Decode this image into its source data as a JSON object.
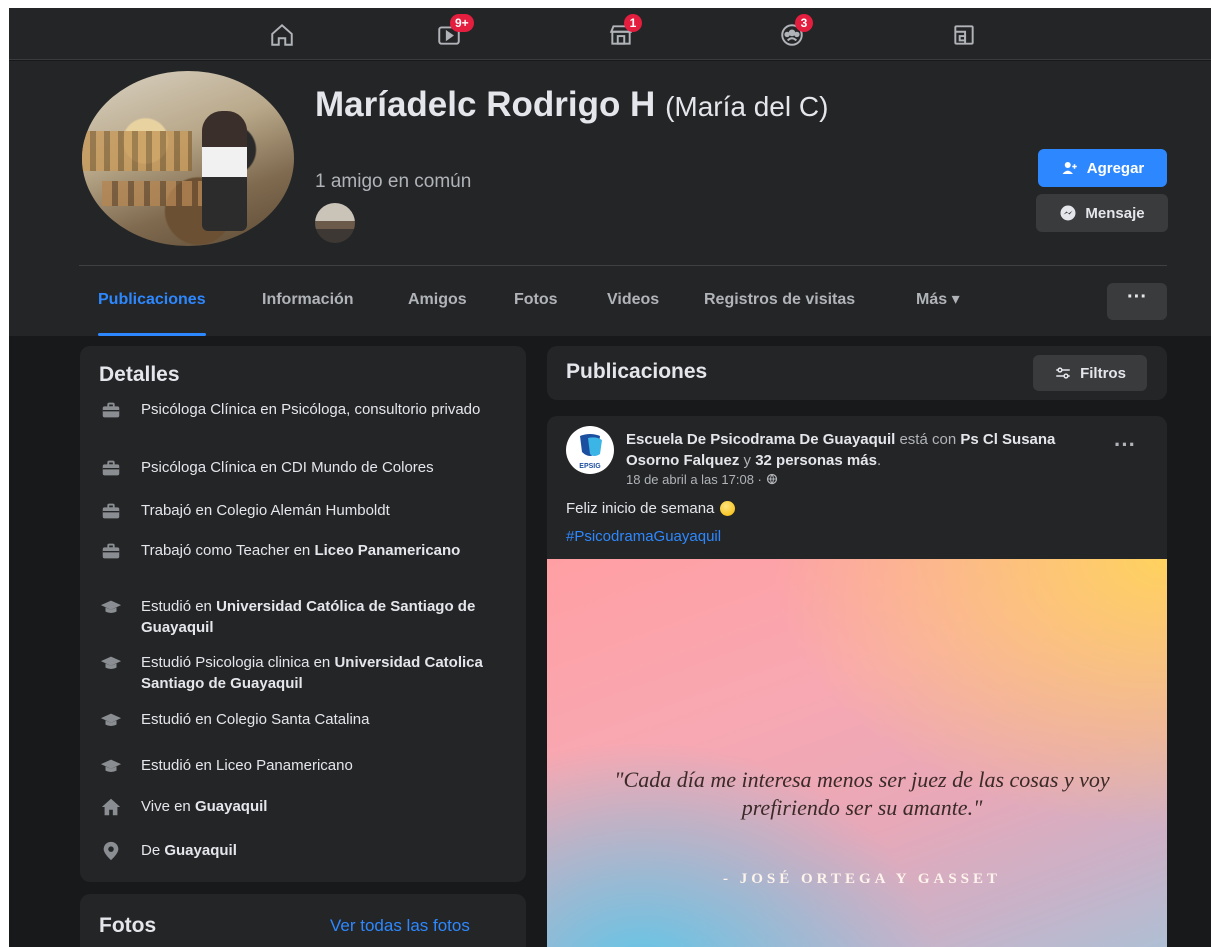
{
  "nav": {
    "badges": {
      "watch": "9+",
      "marketplace": "1",
      "groups": "3"
    }
  },
  "profile": {
    "name": "Maríadelc Rodrigo H",
    "alt_name": "(María del C)",
    "mutual_friends": "1 amigo en común",
    "add_label": "Agregar",
    "message_label": "Mensaje"
  },
  "tabs": [
    "Publicaciones",
    "Información",
    "Amigos",
    "Fotos",
    "Videos",
    "Registros de visitas",
    "Más ▾"
  ],
  "tabs_more": "···",
  "details": {
    "title": "Detalles",
    "rows": [
      {
        "icon": "briefcase-icon",
        "text": "Psicóloga Clínica en Psicóloga, consultorio privado"
      },
      {
        "icon": "briefcase-icon",
        "text": "Psicóloga Clínica en CDI Mundo de Colores"
      },
      {
        "icon": "briefcase-icon",
        "text": "Trabajó en Colegio Alemán Humboldt"
      },
      {
        "icon": "briefcase-icon",
        "prefix": "Trabajó como Teacher en ",
        "bold": "Liceo Panamericano"
      },
      {
        "icon": "graduation-cap-icon",
        "prefix": "Estudió en ",
        "bold": "Universidad Católica de Santiago de Guayaquil"
      },
      {
        "icon": "graduation-cap-icon",
        "prefix": "Estudió Psicologia clinica en ",
        "bold": "Universidad Catolica Santiago de Guayaquil"
      },
      {
        "icon": "graduation-cap-icon",
        "text": "Estudió en Colegio Santa Catalina"
      },
      {
        "icon": "graduation-cap-icon",
        "text": "Estudió en Liceo Panamericano"
      },
      {
        "icon": "home-icon",
        "prefix": "Vive en ",
        "bold": "Guayaquil"
      },
      {
        "icon": "location-pin-icon",
        "prefix": "De ",
        "bold": "Guayaquil"
      }
    ]
  },
  "photos": {
    "title": "Fotos",
    "link": "Ver todas las fotos"
  },
  "posts": {
    "title": "Publicaciones",
    "filter_label": "Filtros",
    "post": {
      "author": "Escuela De Psicodrama De Guayaquil",
      "with_text": " está con ",
      "tagged": "Ps Cl Susana Osorno Falquez",
      "and_text": " y ",
      "others": "32 personas más",
      "period": ".",
      "time": "18 de abril a las 17:08 ·",
      "avatar_text": "EPSIG",
      "more": "···",
      "text": "Feliz inicio de semana",
      "hashtag": "#PsicodramaGuayaquil",
      "quote": "\"Cada día me interesa menos ser juez de las cosas y voy prefiriendo ser su amante.\"",
      "quote_author": "- JOSÉ ORTEGA Y GASSET"
    }
  },
  "colors": {
    "accent": "#2d88ff",
    "badge": "#e41e3f",
    "background": "#18191a",
    "card": "#242526"
  }
}
